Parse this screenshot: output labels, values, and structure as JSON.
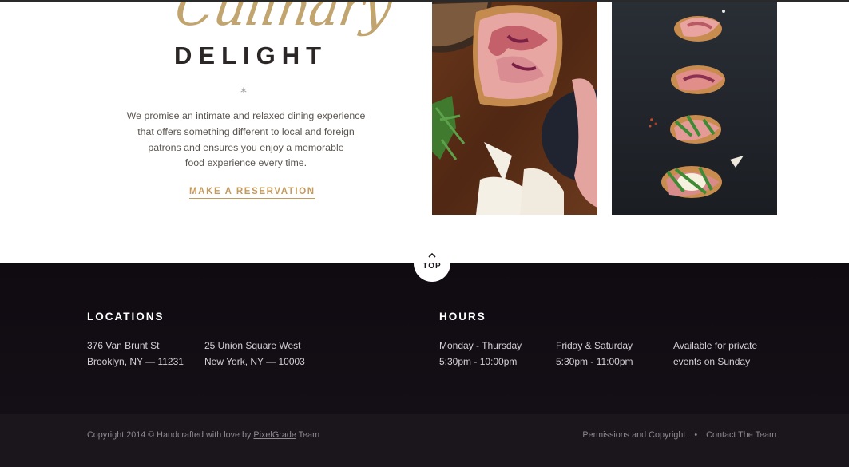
{
  "hero": {
    "script_title": "Culinary",
    "title": "DELIGHT",
    "separator": "*",
    "intro_lines": [
      "We promise an intimate and relaxed dining experience",
      "that offers something different to local and foreign",
      "patrons and ensures you enjoy a memorable",
      "food experience every time."
    ],
    "reservation_label": "MAKE A RESERVATION"
  },
  "top_button": {
    "label": "TOP",
    "icon": "chevron-up-icon"
  },
  "footer": {
    "locations": {
      "heading": "LOCATIONS",
      "items": [
        {
          "line1": "376 Van Brunt St",
          "line2": "Brooklyn, NY — 11231"
        },
        {
          "line1": "25 Union Square West",
          "line2": "New York, NY — 10003"
        }
      ]
    },
    "hours": {
      "heading": "HOURS",
      "items": [
        {
          "line1": "Monday - Thursday",
          "line2": "5:30pm - 10:00pm"
        },
        {
          "line1": "Friday & Saturday",
          "line2": "5:30pm - 11:00pm"
        },
        {
          "line1": "Available for private",
          "line2": "events on Sunday"
        }
      ]
    }
  },
  "subfooter": {
    "copyright_prefix": "Copyright 2014 © Handcrafted with love by",
    "copyright_link": "PixelGrade",
    "copyright_suffix": "Team",
    "links": [
      "Permissions and Copyright",
      "Contact The Team"
    ],
    "separator": "•"
  },
  "colors": {
    "gold": "#c2a46e",
    "accent": "#c49a5d",
    "footer_bg": "#120d14",
    "subfooter_bg": "#1a161c"
  }
}
